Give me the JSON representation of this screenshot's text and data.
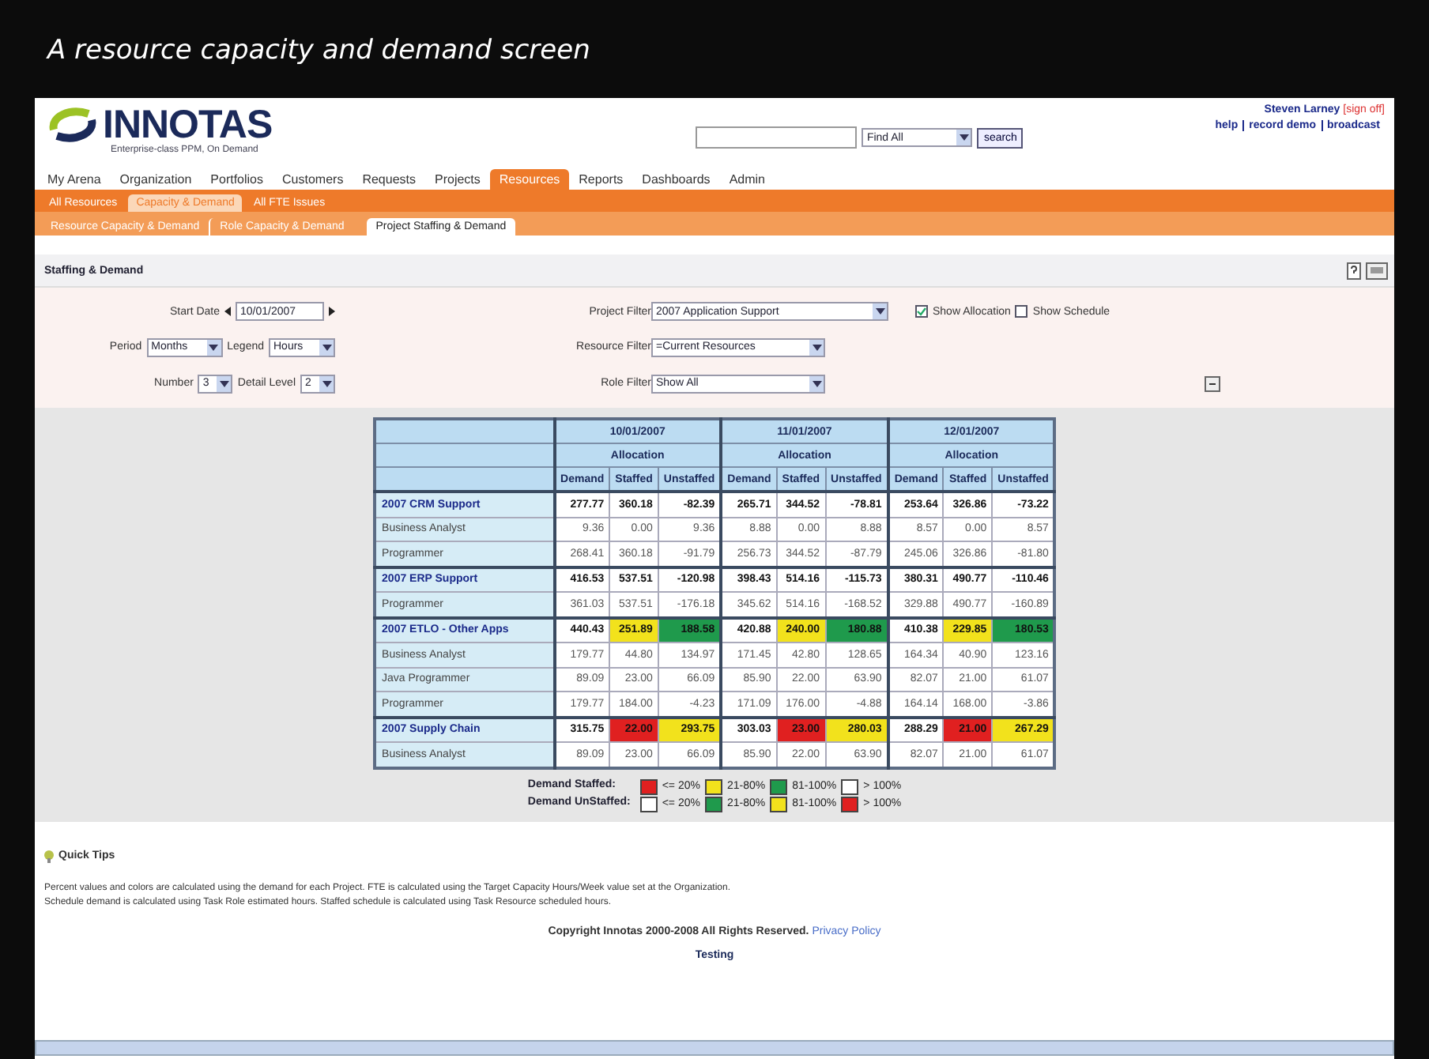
{
  "caption": "A resource capacity and demand screen",
  "header": {
    "logo": "INNOTAS",
    "tagline": "Enterprise-class PPM, On Demand",
    "search": {
      "scope": "Find All",
      "button": "search"
    },
    "user": "Steven Larney",
    "signoff": "[sign off]",
    "links": [
      "help",
      "record demo",
      "broadcast"
    ]
  },
  "nav": [
    {
      "label": "My Arena",
      "selected": false
    },
    {
      "label": "Organization",
      "selected": false
    },
    {
      "label": "Portfolios",
      "selected": false
    },
    {
      "label": "Customers",
      "selected": false
    },
    {
      "label": "Requests",
      "selected": false
    },
    {
      "label": "Projects",
      "selected": false
    },
    {
      "label": "Resources",
      "selected": true
    },
    {
      "label": "Reports",
      "selected": false
    },
    {
      "label": "Dashboards",
      "selected": false
    },
    {
      "label": "Admin",
      "selected": false
    }
  ],
  "subnav": [
    {
      "label": "All Resources",
      "selected": false
    },
    {
      "label": "Capacity & Demand",
      "selected": true
    },
    {
      "label": "All FTE Issues",
      "selected": false
    }
  ],
  "pagetabs": [
    {
      "label": "Resource Capacity & Demand",
      "selected": false
    },
    {
      "label": "Role Capacity & Demand",
      "selected": false
    },
    {
      "label": "Project Staffing & Demand",
      "selected": true
    }
  ],
  "section_title": "Staffing & Demand",
  "filters": {
    "start_date": {
      "label": "Start Date",
      "value": "10/01/2007"
    },
    "project_filter": {
      "label": "Project Filter",
      "value": "2007 Application Support"
    },
    "show_allocation": {
      "label": "Show Allocation",
      "checked": true
    },
    "show_schedule": {
      "label": "Show Schedule",
      "checked": false
    },
    "period": {
      "label": "Period",
      "value": "Months"
    },
    "legend": {
      "label": "Legend",
      "value": "Hours"
    },
    "resource_filter": {
      "label": "Resource Filter",
      "value": "=Current Resources"
    },
    "number": {
      "label": "Number",
      "value": "3"
    },
    "detail_level": {
      "label": "Detail Level",
      "value": "2"
    },
    "role_filter": {
      "label": "Role Filter",
      "value": "Show All"
    }
  },
  "table": {
    "months": [
      {
        "date": "10/01/2007",
        "group": "Allocation",
        "columns": [
          "Demand",
          "Staffed",
          "Unstaffed"
        ]
      },
      {
        "date": "11/01/2007",
        "group": "Allocation",
        "columns": [
          "Demand",
          "Staffed",
          "Unstaffed"
        ]
      },
      {
        "date": "12/01/2007",
        "group": "Allocation",
        "columns": [
          "Demand",
          "Staffed",
          "Unstaffed"
        ]
      }
    ],
    "rows": [
      {
        "kind": "project",
        "name": "2007 CRM Support",
        "cells": [
          {
            "text": "277.77"
          },
          {
            "text": "360.18"
          },
          {
            "text": "-82.39"
          },
          {
            "text": "265.71"
          },
          {
            "text": "344.52"
          },
          {
            "text": "-78.81"
          },
          {
            "text": "253.64"
          },
          {
            "text": "326.86"
          },
          {
            "text": "-73.22"
          }
        ]
      },
      {
        "kind": "role",
        "name": "Business Analyst",
        "cells": [
          {
            "text": "9.36"
          },
          {
            "text": "0.00"
          },
          {
            "text": "9.36"
          },
          {
            "text": "8.88"
          },
          {
            "text": "0.00"
          },
          {
            "text": "8.88"
          },
          {
            "text": "8.57"
          },
          {
            "text": "0.00"
          },
          {
            "text": "8.57"
          }
        ]
      },
      {
        "kind": "role",
        "name": "Programmer",
        "cells": [
          {
            "text": "268.41"
          },
          {
            "text": "360.18"
          },
          {
            "text": "-91.79"
          },
          {
            "text": "256.73"
          },
          {
            "text": "344.52"
          },
          {
            "text": "-87.79"
          },
          {
            "text": "245.06"
          },
          {
            "text": "326.86"
          },
          {
            "text": "-81.80"
          }
        ]
      },
      {
        "kind": "project",
        "name": "2007 ERP Support",
        "cells": [
          {
            "text": "416.53"
          },
          {
            "text": "537.51"
          },
          {
            "text": "-120.98"
          },
          {
            "text": "398.43"
          },
          {
            "text": "514.16"
          },
          {
            "text": "-115.73"
          },
          {
            "text": "380.31"
          },
          {
            "text": "490.77"
          },
          {
            "text": "-110.46"
          }
        ]
      },
      {
        "kind": "role",
        "name": "Programmer",
        "cells": [
          {
            "text": "361.03"
          },
          {
            "text": "537.51"
          },
          {
            "text": "-176.18"
          },
          {
            "text": "345.62"
          },
          {
            "text": "514.16"
          },
          {
            "text": "-168.52"
          },
          {
            "text": "329.88"
          },
          {
            "text": "490.77"
          },
          {
            "text": "-160.89"
          }
        ]
      },
      {
        "kind": "project",
        "name": "2007 ETLO - Other Apps",
        "cells": [
          {
            "text": "440.43"
          },
          {
            "text": "251.89",
            "color": "#f2e21c"
          },
          {
            "text": "188.58",
            "color": "#1f9a4c"
          },
          {
            "text": "420.88"
          },
          {
            "text": "240.00",
            "color": "#f2e21c"
          },
          {
            "text": "180.88",
            "color": "#1f9a4c"
          },
          {
            "text": "410.38"
          },
          {
            "text": "229.85",
            "color": "#f2e21c"
          },
          {
            "text": "180.53",
            "color": "#1f9a4c"
          }
        ]
      },
      {
        "kind": "role",
        "name": "Business Analyst",
        "cells": [
          {
            "text": "179.77"
          },
          {
            "text": "44.80"
          },
          {
            "text": "134.97"
          },
          {
            "text": "171.45"
          },
          {
            "text": "42.80"
          },
          {
            "text": "128.65"
          },
          {
            "text": "164.34"
          },
          {
            "text": "40.90"
          },
          {
            "text": "123.16"
          }
        ]
      },
      {
        "kind": "role",
        "name": "Java Programmer",
        "cells": [
          {
            "text": "89.09"
          },
          {
            "text": "23.00"
          },
          {
            "text": "66.09"
          },
          {
            "text": "85.90"
          },
          {
            "text": "22.00"
          },
          {
            "text": "63.90"
          },
          {
            "text": "82.07"
          },
          {
            "text": "21.00"
          },
          {
            "text": "61.07"
          }
        ]
      },
      {
        "kind": "role",
        "name": "Programmer",
        "cells": [
          {
            "text": "179.77"
          },
          {
            "text": "184.00"
          },
          {
            "text": "-4.23"
          },
          {
            "text": "171.09"
          },
          {
            "text": "176.00"
          },
          {
            "text": "-4.88"
          },
          {
            "text": "164.14"
          },
          {
            "text": "168.00"
          },
          {
            "text": "-3.86"
          }
        ]
      },
      {
        "kind": "project",
        "name": "2007 Supply Chain",
        "cells": [
          {
            "text": "315.75"
          },
          {
            "text": "22.00",
            "color": "#e02020"
          },
          {
            "text": "293.75",
            "color": "#f2e21c"
          },
          {
            "text": "303.03"
          },
          {
            "text": "23.00",
            "color": "#e02020"
          },
          {
            "text": "280.03",
            "color": "#f2e21c"
          },
          {
            "text": "288.29"
          },
          {
            "text": "21.00",
            "color": "#e02020"
          },
          {
            "text": "267.29",
            "color": "#f2e21c"
          }
        ]
      },
      {
        "kind": "role",
        "name": "Business Analyst",
        "cells": [
          {
            "text": "89.09"
          },
          {
            "text": "23.00"
          },
          {
            "text": "66.09"
          },
          {
            "text": "85.90"
          },
          {
            "text": "22.00"
          },
          {
            "text": "63.90"
          },
          {
            "text": "82.07"
          },
          {
            "text": "21.00"
          },
          {
            "text": "61.07"
          }
        ]
      }
    ]
  },
  "legend": [
    {
      "label": "Demand Staffed:",
      "items": [
        {
          "color": "#e02020",
          "text": "<= 20%"
        },
        {
          "color": "#f2e21c",
          "text": "21-80%"
        },
        {
          "color": "#1f9a4c",
          "text": "81-100%"
        },
        {
          "color": "#ffffff",
          "text": "> 100%"
        }
      ]
    },
    {
      "label": "Demand UnStaffed:",
      "items": [
        {
          "color": "#ffffff",
          "text": "<= 20%"
        },
        {
          "color": "#1f9a4c",
          "text": "21-80%"
        },
        {
          "color": "#f2e21c",
          "text": "81-100%"
        },
        {
          "color": "#e02020",
          "text": "> 100%"
        }
      ]
    }
  ],
  "quick_tips": {
    "title": "Quick Tips",
    "lines": [
      "Percent values and colors are calculated using the demand for each Project. FTE is calculated using the Target Capacity Hours/Week value set at the Organization.",
      "Schedule demand is calculated using Task Role estimated hours. Staffed schedule is calculated using Task Resource scheduled hours."
    ]
  },
  "footer": {
    "copyright": "Copyright Innotas 2000-2008 All Rights Reserved.",
    "privacy": "Privacy Policy",
    "env": "Testing"
  }
}
